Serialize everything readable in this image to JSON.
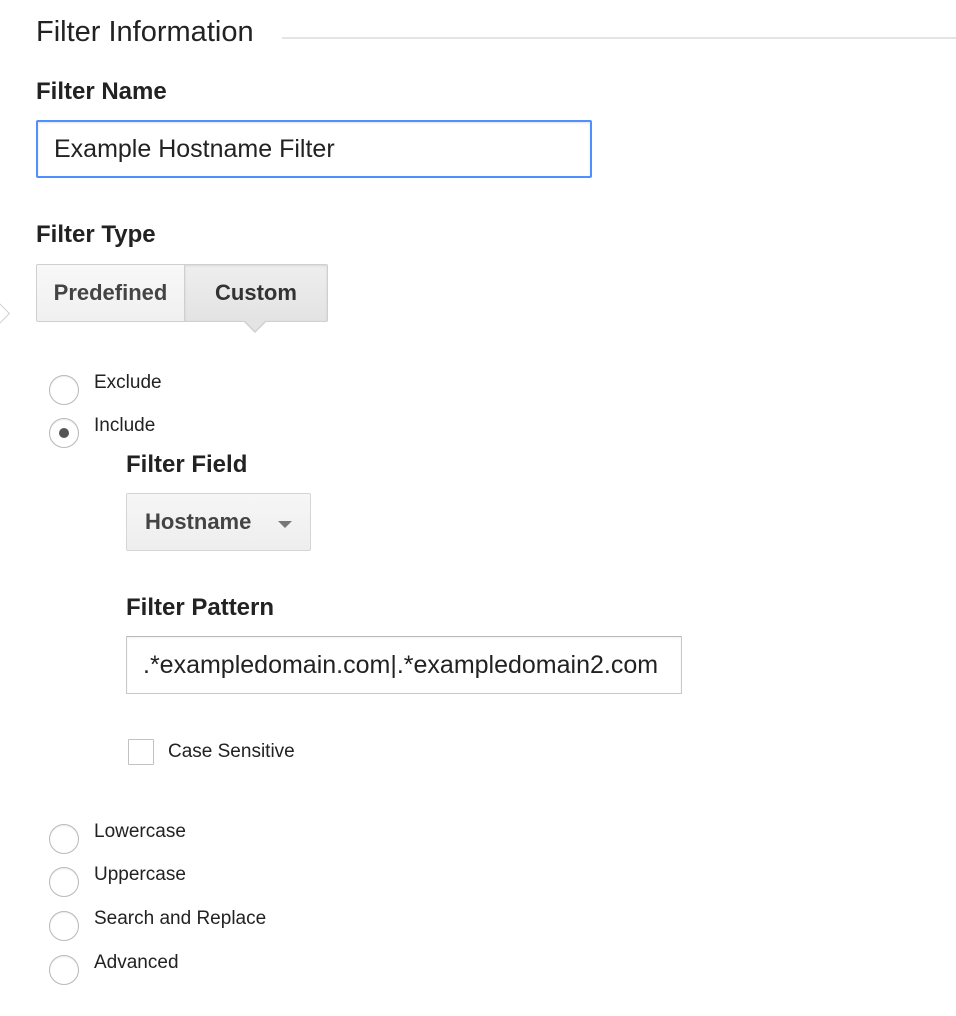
{
  "section": {
    "title": "Filter Information"
  },
  "filter_name": {
    "label": "Filter Name",
    "value": "Example Hostname Filter"
  },
  "filter_type": {
    "label": "Filter Type",
    "tabs": [
      {
        "label": "Predefined",
        "selected": false
      },
      {
        "label": "Custom",
        "selected": true
      }
    ]
  },
  "custom_options": {
    "exclude_label": "Exclude",
    "include_label": "Include",
    "selected": "Include",
    "filter_field": {
      "label": "Filter Field",
      "value": "Hostname"
    },
    "filter_pattern": {
      "label": "Filter Pattern",
      "value": ".*exampledomain.com|.*exampledomain2.com"
    },
    "case_sensitive": {
      "label": "Case Sensitive",
      "checked": false
    },
    "other_options": [
      "Lowercase",
      "Uppercase",
      "Search and Replace",
      "Advanced"
    ]
  }
}
